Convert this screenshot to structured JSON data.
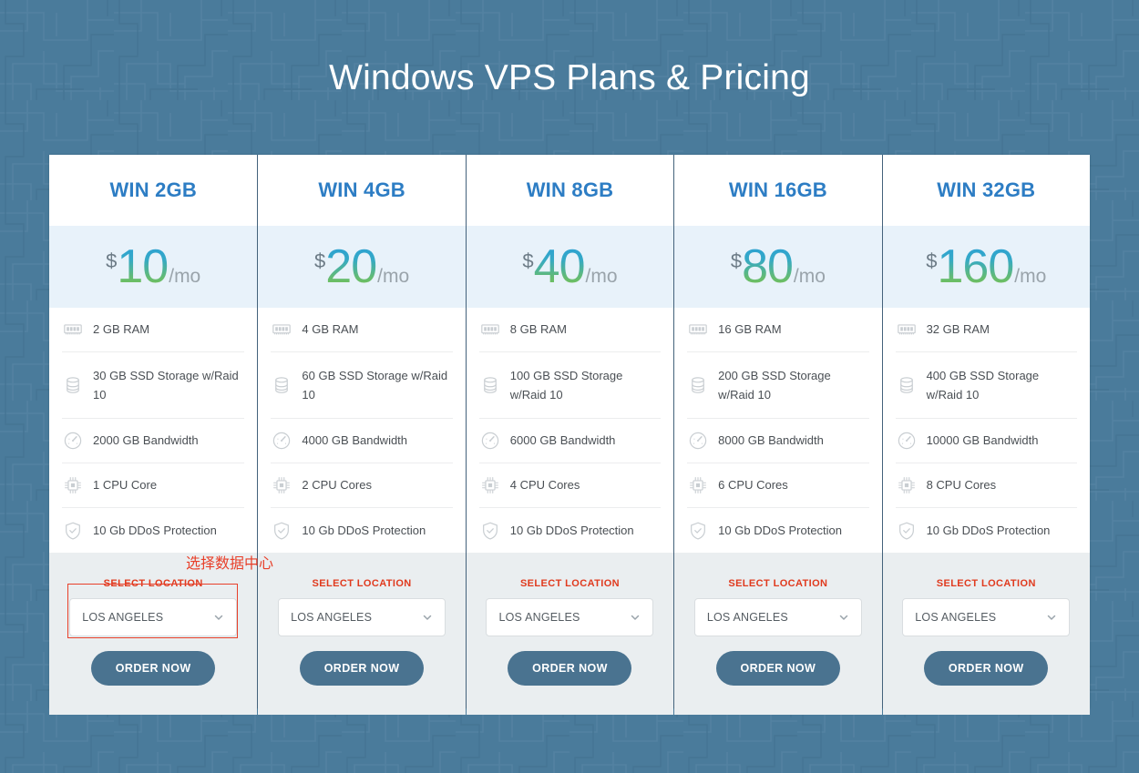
{
  "page": {
    "title": "Windows VPS Plans & Pricing",
    "background_color": "#4a7b9b",
    "title_color": "#ffffff"
  },
  "theme": {
    "plan_title_color": "#2d7dc4",
    "price_gradient_from": "#2a9fd6",
    "price_gradient_to": "#7dc242",
    "price_band_bg": "#e8f2fa",
    "footer_bg": "#eaeef0",
    "button_bg": "#4a7390",
    "select_label_color": "#e03a1e",
    "annotation_color": "#e8402a"
  },
  "labels": {
    "currency_symbol": "$",
    "period": "/mo",
    "select_location": "SELECT LOCATION",
    "order_now": "ORDER NOW",
    "chevron_icon": "chevron-down-icon"
  },
  "annotations": [
    {
      "text": "选择数据中心",
      "type": "callout-text"
    },
    {
      "text": "",
      "type": "highlight-box"
    }
  ],
  "plans": [
    {
      "name": "WIN 2GB",
      "price": "10",
      "location": "LOS ANGELES",
      "features": [
        {
          "icon": "ram-icon",
          "text": "2 GB RAM"
        },
        {
          "icon": "storage-icon",
          "text": "30 GB SSD Storage w/Raid 10"
        },
        {
          "icon": "bandwidth-icon",
          "text": "2000 GB Bandwidth"
        },
        {
          "icon": "cpu-icon",
          "text": "1 CPU Core"
        },
        {
          "icon": "shield-icon",
          "text": "10 Gb DDoS Protection"
        }
      ]
    },
    {
      "name": "WIN 4GB",
      "price": "20",
      "location": "LOS ANGELES",
      "features": [
        {
          "icon": "ram-icon",
          "text": "4 GB RAM"
        },
        {
          "icon": "storage-icon",
          "text": "60 GB SSD Storage w/Raid 10"
        },
        {
          "icon": "bandwidth-icon",
          "text": "4000 GB Bandwidth"
        },
        {
          "icon": "cpu-icon",
          "text": "2 CPU Cores"
        },
        {
          "icon": "shield-icon",
          "text": "10 Gb DDoS Protection"
        }
      ]
    },
    {
      "name": "WIN 8GB",
      "price": "40",
      "location": "LOS ANGELES",
      "features": [
        {
          "icon": "ram-icon",
          "text": "8 GB RAM"
        },
        {
          "icon": "storage-icon",
          "text": "100 GB SSD Storage w/Raid 10"
        },
        {
          "icon": "bandwidth-icon",
          "text": "6000 GB Bandwidth"
        },
        {
          "icon": "cpu-icon",
          "text": "4 CPU Cores"
        },
        {
          "icon": "shield-icon",
          "text": "10 Gb DDoS Protection"
        }
      ]
    },
    {
      "name": "WIN 16GB",
      "price": "80",
      "location": "LOS ANGELES",
      "features": [
        {
          "icon": "ram-icon",
          "text": "16 GB RAM"
        },
        {
          "icon": "storage-icon",
          "text": "200 GB SSD Storage w/Raid 10"
        },
        {
          "icon": "bandwidth-icon",
          "text": "8000 GB Bandwidth"
        },
        {
          "icon": "cpu-icon",
          "text": "6 CPU Cores"
        },
        {
          "icon": "shield-icon",
          "text": "10 Gb DDoS Protection"
        }
      ]
    },
    {
      "name": "WIN 32GB",
      "price": "160",
      "location": "LOS ANGELES",
      "features": [
        {
          "icon": "ram-icon",
          "text": "32 GB RAM"
        },
        {
          "icon": "storage-icon",
          "text": "400 GB SSD Storage w/Raid 10"
        },
        {
          "icon": "bandwidth-icon",
          "text": "10000 GB Bandwidth"
        },
        {
          "icon": "cpu-icon",
          "text": "8 CPU Cores"
        },
        {
          "icon": "shield-icon",
          "text": "10 Gb DDoS Protection"
        }
      ]
    }
  ]
}
